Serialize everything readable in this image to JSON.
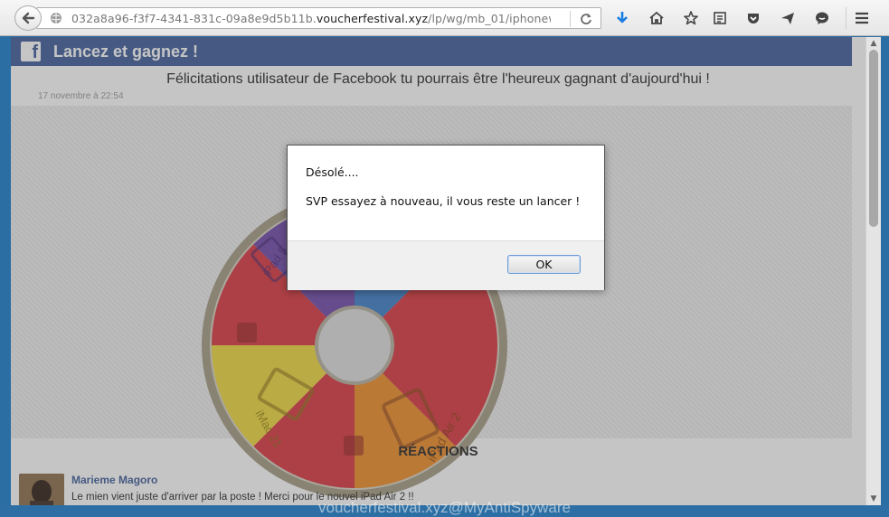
{
  "browser": {
    "url_prefix": "032a8a96-f3f7-4341-831c-09a8e9d5b11b.",
    "url_host": "voucherfestival.xyz",
    "url_path": "/lp/wg/mb_01/iphonew"
  },
  "page": {
    "header_title": "Lancez et gagnez !",
    "headline": "Félicitations utilisateur de Facebook tu pourrais être l'heureux gagnant d'aujourd'hui !",
    "date": "17 novembre à 22:54",
    "wheel_labels": [
      "iPad 5",
      "iPad Air 2",
      "iMac 21"
    ],
    "reactions_title": "RÉACTIONS",
    "comment": {
      "author": "Marieme Magoro",
      "text": "Le mien vient juste d'arriver par la poste ! Merci pour le nouvel iPad Air 2 !!"
    }
  },
  "dialog": {
    "title": "Désolé....",
    "message": "SVP essayez à nouveau, il vous reste un lancer !",
    "ok_label": "OK"
  },
  "watermark": "voucherfestival.xyz@MyAntiSpyware",
  "colors": {
    "facebook_blue": "#3b5998",
    "wheel_red": "#d9343c",
    "wheel_yellow": "#f0d83a",
    "wheel_orange": "#f08a24",
    "wheel_purple": "#6e46a8",
    "wheel_blue": "#3a7bc8"
  }
}
